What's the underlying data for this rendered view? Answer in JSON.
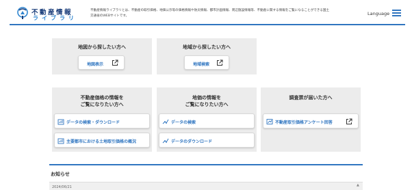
{
  "header": {
    "logo_title": "不動産情報",
    "logo_sub": "ライブラリ",
    "intro": "不動産情報ライブラリとは、不動産の取引価格、地価公示等の価格情報や防災情報、都市計画情報、周辺施設情報等、不動産に関する情報をご覧になることができる国土交通省のWEBサイトです。",
    "language": "Language"
  },
  "panels": {
    "map": {
      "title": "地図から探したい方へ",
      "button": "地図表示"
    },
    "area": {
      "title": "地域から探したい方へ",
      "button": "地域検索"
    },
    "price": {
      "title_line1": "不動産価格の情報を",
      "title_line2": "ご覧になりたい方へ",
      "button1": "データの検索・ダウンロード",
      "button2": "主要都市における土地取引価格の概況"
    },
    "land": {
      "title_line1": "地価の情報を",
      "title_line2": "ご覧になりたい方へ",
      "button1": "データの検索",
      "button2": "データのダウンロード"
    },
    "survey": {
      "title": "調査票が届いた方へ",
      "button": "不動産取引価格アンケート回答"
    }
  },
  "news": {
    "title": "お知らせ",
    "first_date": "2024/06/21"
  },
  "colors": {
    "accent": "#2f75c0",
    "panel_bg": "#ececec"
  }
}
